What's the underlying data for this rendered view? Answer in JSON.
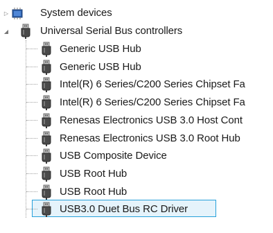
{
  "tree": {
    "system_devices": {
      "label": "System devices",
      "expanded": false,
      "icon": "computer-chip-icon"
    },
    "usb_controllers": {
      "label": "Universal Serial Bus controllers",
      "expanded": true,
      "icon": "usb-plug-icon",
      "children": [
        {
          "label": "Generic USB Hub"
        },
        {
          "label": "Generic USB Hub"
        },
        {
          "label": "Intel(R) 6 Series/C200 Series Chipset Fa"
        },
        {
          "label": "Intel(R) 6 Series/C200 Series Chipset Fa"
        },
        {
          "label": "Renesas Electronics USB 3.0 Host Cont"
        },
        {
          "label": "Renesas Electronics USB 3.0 Root Hub"
        },
        {
          "label": "USB Composite Device"
        },
        {
          "label": "USB Root Hub"
        },
        {
          "label": "USB Root Hub"
        },
        {
          "label": "USB3.0 Duet Bus RC Driver",
          "selected": true
        }
      ]
    }
  },
  "colors": {
    "selection_border": "#26a0da",
    "selection_fill": "#e5f3fb",
    "text": "#1a1a1a"
  }
}
